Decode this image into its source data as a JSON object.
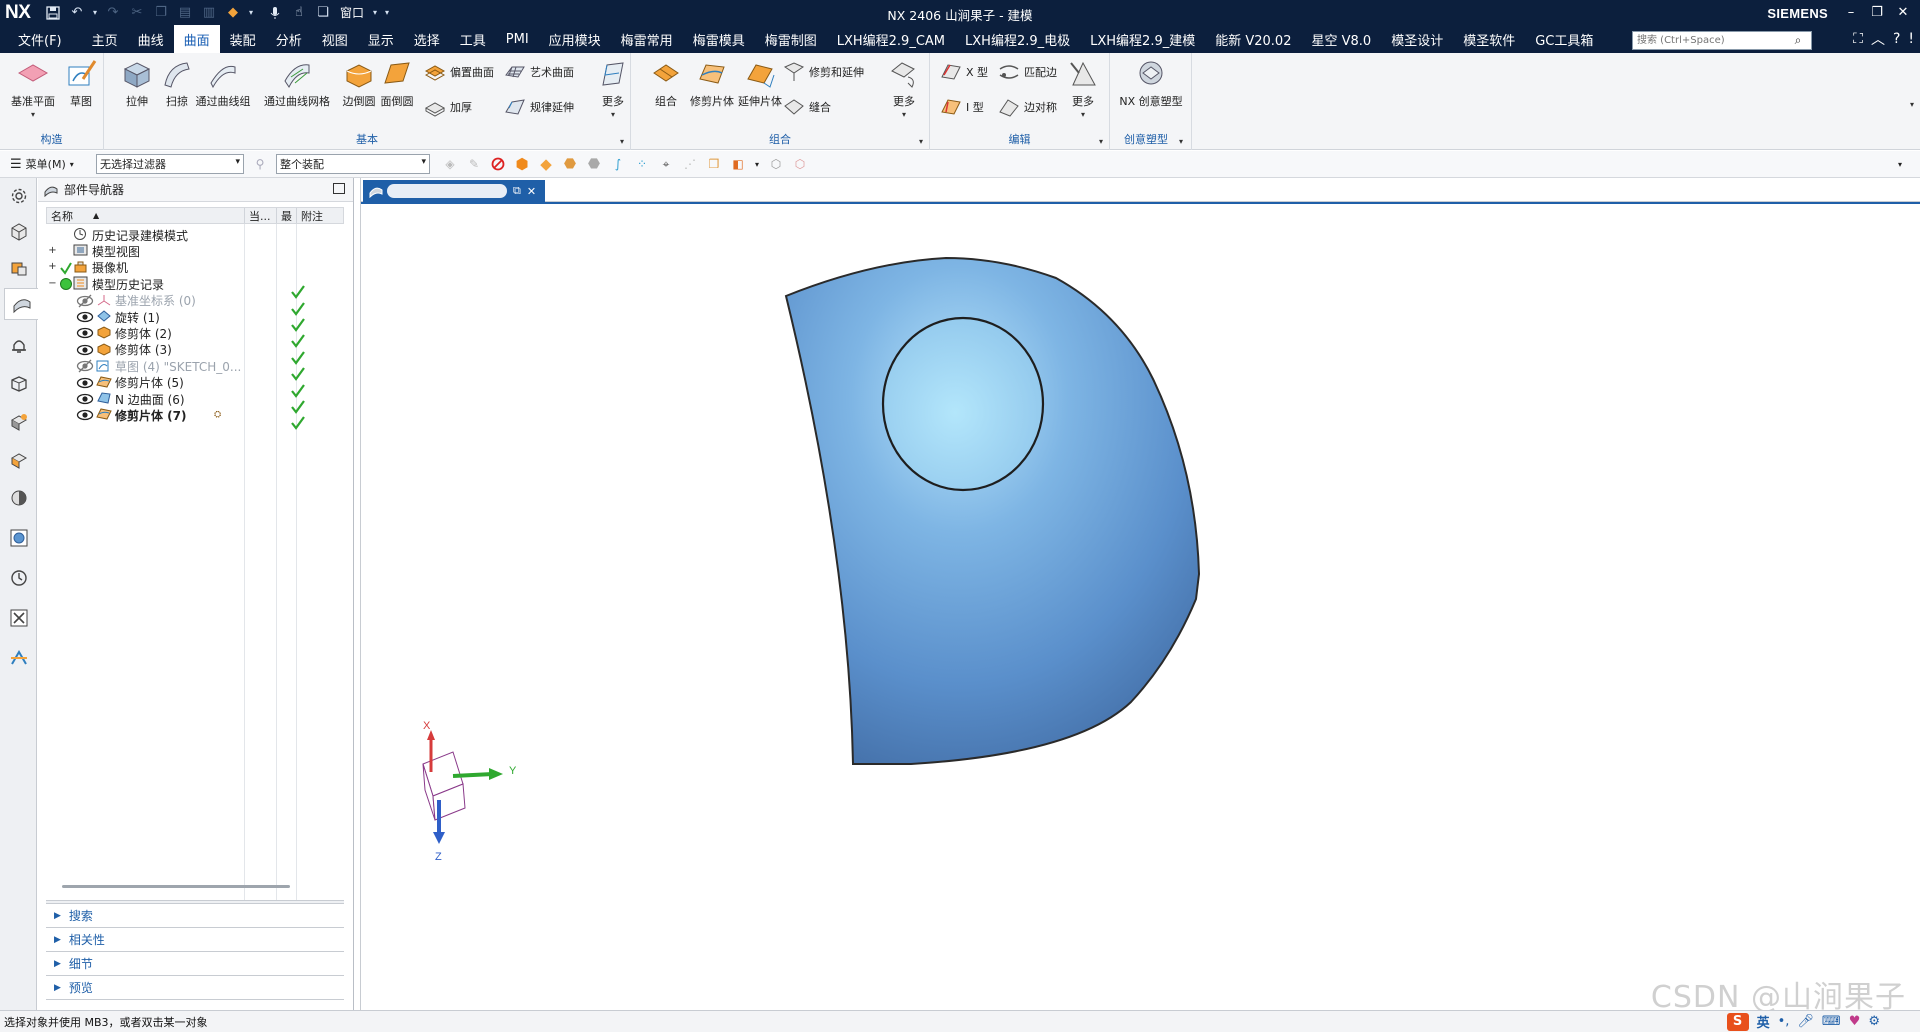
{
  "titlebar": {
    "app_logo": "NX",
    "title": "NX 2406 山涧果子 - 建模",
    "window_menu": "窗口",
    "brand": "SIEMENS",
    "icons": [
      "save-icon",
      "undo-icon",
      "redo-icon",
      "cut-icon",
      "copy-icon",
      "paste-icon",
      "command-finder-icon",
      "mic-icon",
      "touch-mode-icon",
      "window-icon"
    ]
  },
  "menubar": {
    "file": "文件(F)",
    "tabs": [
      "主页",
      "曲线",
      "曲面",
      "装配",
      "分析",
      "视图",
      "显示",
      "选择",
      "工具",
      "PMI",
      "应用模块",
      "梅雷常用",
      "梅雷模具",
      "梅雷制图",
      "LXH编程2.9_CAM",
      "LXH编程2.9_电极",
      "LXH编程2.9_建模",
      "能新 V20.02",
      "星空 V8.0",
      "模圣设计",
      "模圣软件",
      "GC工具箱"
    ],
    "active_tab": "曲面",
    "search_placeholder": "搜索 (Ctrl+Space)"
  },
  "ribbon": {
    "groups": [
      {
        "label": "构造",
        "buttons": [
          "基准平面",
          "草图"
        ]
      },
      {
        "label": "基本",
        "big_buttons": [
          "拉伸",
          "扫掠",
          "通过曲线组",
          "通过曲线网格",
          "边倒圆",
          "面倒圆"
        ],
        "small_buttons": [
          "偏置曲面",
          "加厚",
          "艺术曲面",
          "规律延伸"
        ],
        "more": "更多"
      },
      {
        "label": "组合",
        "big_buttons": [
          "组合",
          "修剪片体",
          "延伸片体"
        ],
        "small_buttons": [
          "修剪和延伸",
          "缝合"
        ],
        "more": "更多"
      },
      {
        "label": "编辑",
        "small_buttons": [
          "X 型",
          "I 型",
          "匹配边",
          "边对称"
        ],
        "more": "更多"
      },
      {
        "label": "创意塑型",
        "buttons": [
          "NX 创意塑型"
        ]
      }
    ]
  },
  "toolbar2": {
    "menu_label": "菜单(M)",
    "filter_value": "无选择过滤器",
    "assembly_value": "整个装配"
  },
  "navigator": {
    "title": "部件导航器",
    "columns": [
      "名称",
      "当...",
      "最",
      "附注"
    ],
    "rows": [
      {
        "name": "历史记录建模模式",
        "level": 0,
        "icon": "clock-icon",
        "check": false
      },
      {
        "name": "模型视图",
        "level": 0,
        "icon": "model-views-icon",
        "expand": "+",
        "check": false
      },
      {
        "name": "摄像机",
        "level": 0,
        "icon": "camera-icon",
        "expand": "+",
        "check": false,
        "tick": true
      },
      {
        "name": "模型历史记录",
        "level": 0,
        "icon": "history-icon",
        "expand": "−",
        "check": true,
        "status_dot": true
      },
      {
        "name": "基准坐标系 (0)",
        "level": 1,
        "icon": "datum-csys-icon",
        "hidden": true,
        "check": true
      },
      {
        "name": "旋转 (1)",
        "level": 1,
        "icon": "revolve-icon",
        "check": true
      },
      {
        "name": "修剪体 (2)",
        "level": 1,
        "icon": "trim-body-icon",
        "check": true
      },
      {
        "name": "修剪体 (3)",
        "level": 1,
        "icon": "trim-body-icon",
        "check": true
      },
      {
        "name": "草图 (4) \"SKETCH_0...",
        "level": 1,
        "icon": "sketch-icon",
        "hidden": true,
        "check": true
      },
      {
        "name": "修剪片体 (5)",
        "level": 1,
        "icon": "trim-sheet-icon",
        "check": true
      },
      {
        "name": "N 边曲面 (6)",
        "level": 1,
        "icon": "n-sided-surface-icon",
        "check": true
      },
      {
        "name": "修剪片体 (7)",
        "level": 1,
        "icon": "trim-sheet-icon",
        "check": true,
        "current": true
      }
    ],
    "sections": [
      "搜索",
      "相关性",
      "细节",
      "预览"
    ]
  },
  "graphics": {
    "tab_icon": "part-icon",
    "triad_labels": [
      "X",
      "Y",
      "Z"
    ]
  },
  "statusbar": {
    "prompt": "选择对象并使用 MB3，或者双击某一对象",
    "watermark": "CSDN @山涧果子",
    "ime_label": "英"
  },
  "colors": {
    "title_bg": "#0c1f3d",
    "accent": "#1f5fa8",
    "surface": "#5b95d0",
    "check_green": "#2fa82f"
  }
}
